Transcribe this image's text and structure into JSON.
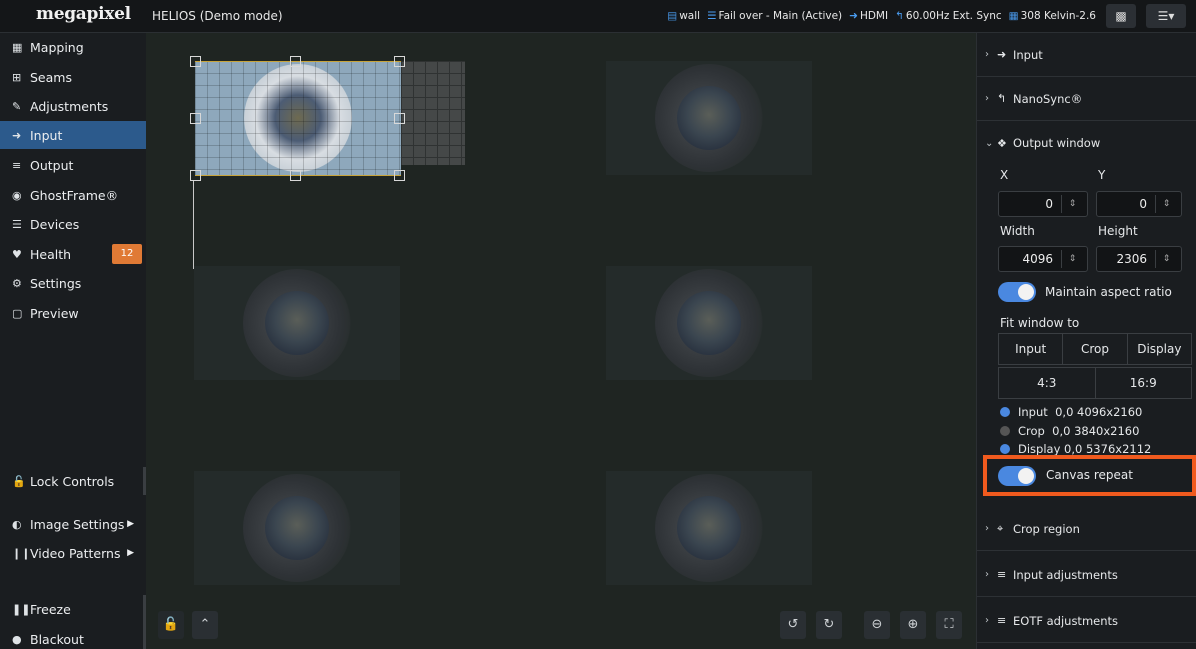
{
  "header": {
    "logo": "megapixel",
    "title": "HELIOS (Demo mode)",
    "status": [
      {
        "icon": "database-icon",
        "text": "wall"
      },
      {
        "icon": "server-icon",
        "text": "Fail over - Main (Active)"
      },
      {
        "icon": "input-icon",
        "text": "HDMI"
      },
      {
        "icon": "sync-icon",
        "text": "60.00Hz Ext. Sync"
      },
      {
        "icon": "grid-icon",
        "text": "308 Kelvin-2.6"
      }
    ]
  },
  "sidebar": {
    "items": [
      {
        "label": "Mapping",
        "icon": "table-icon"
      },
      {
        "label": "Seams",
        "icon": "seams-icon"
      },
      {
        "label": "Adjustments",
        "icon": "brush-icon"
      },
      {
        "label": "Input",
        "icon": "input-icon"
      },
      {
        "label": "Output",
        "icon": "sliders-icon"
      },
      {
        "label": "GhostFrame®",
        "icon": "ghostframe-icon"
      },
      {
        "label": "Devices",
        "icon": "list-icon"
      },
      {
        "label": "Health",
        "icon": "heartbeat-icon",
        "badge": "12"
      },
      {
        "label": "Settings",
        "icon": "gears-icon"
      },
      {
        "label": "Preview",
        "icon": "monitor-icon"
      }
    ],
    "lock_controls": "Lock Controls",
    "image_settings": "Image Settings",
    "video_patterns": "Video Patterns",
    "freeze": "Freeze",
    "blackout": "Blackout"
  },
  "panel": {
    "sections": {
      "input": "Input",
      "nanosync": "NanoSync®",
      "output_window": "Output window",
      "crop_region": "Crop region",
      "input_adjustments": "Input adjustments",
      "eotf_adjustments": "EOTF adjustments"
    },
    "x_label": "X",
    "y_label": "Y",
    "x_value": "0",
    "y_value": "0",
    "width_label": "Width",
    "height_label": "Height",
    "width_value": "4096",
    "height_value": "2306",
    "maintain_aspect": "Maintain aspect ratio",
    "fit_window_to": "Fit window to",
    "fit_options": [
      "Input",
      "Crop",
      "Display"
    ],
    "ratio_options": [
      "4:3",
      "16:9"
    ],
    "legend": [
      {
        "name": "Input",
        "value": "0,0 4096x2160",
        "color": "#4a88e0"
      },
      {
        "name": "Crop",
        "value": "0,0 3840x2160",
        "color": "#555555"
      },
      {
        "name": "Display",
        "value": "0,0 5376x2112",
        "color": "#4a88e0"
      }
    ],
    "canvas_repeat": "Canvas repeat"
  },
  "colors": {
    "accent": "#4a88e0",
    "active_nav": "#2c5a8c",
    "badge": "#e07a35",
    "highlight": "#f05a1e"
  }
}
